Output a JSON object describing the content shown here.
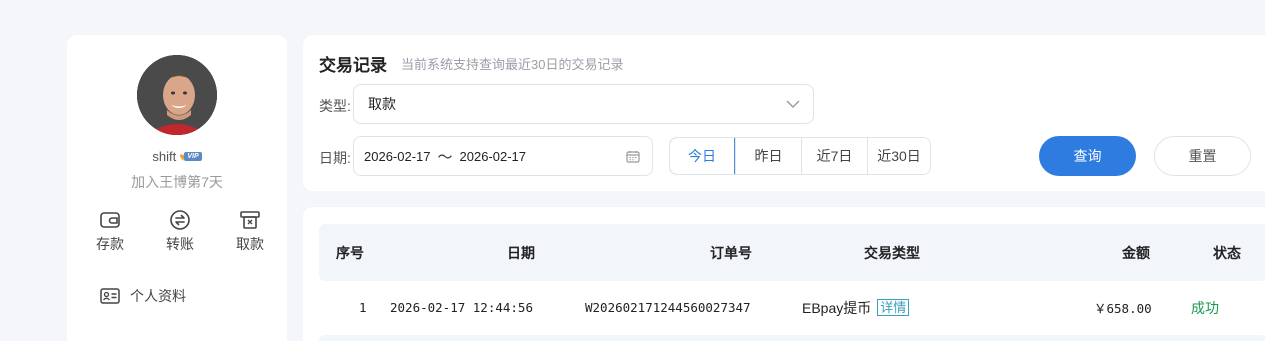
{
  "sidebar": {
    "username": "shift",
    "vip_label": "VIP",
    "join_text": "加入王博第7天",
    "actions": [
      {
        "label": "存款",
        "icon": "wallet-icon"
      },
      {
        "label": "转账",
        "icon": "transfer-icon"
      },
      {
        "label": "取款",
        "icon": "atm-withdraw-icon"
      }
    ],
    "profile_link": {
      "label": "个人资料",
      "icon": "id-card-icon"
    }
  },
  "filter": {
    "title": "交易记录",
    "subtitle": "当前系统支持查询最近30日的交易记录",
    "type_label": "类型:",
    "type_value": "取款",
    "date_label": "日期:",
    "date_start": "2026-02-17",
    "date_sep": "〜",
    "date_end": "2026-02-17",
    "quick_ranges": [
      "今日",
      "昨日",
      "近7日",
      "近30日"
    ],
    "active_range": "今日",
    "query_label": "查询",
    "reset_label": "重置"
  },
  "table": {
    "columns": [
      "序号",
      "日期",
      "订单号",
      "交易类型",
      "金额",
      "状态"
    ],
    "rows": [
      {
        "index": "1",
        "date": "2026-02-17 12:44:56",
        "order_no": "W202602171244560027347",
        "type": "EBpay提币",
        "detail_label": "详情",
        "amount": "￥658.00",
        "status": "成功"
      }
    ]
  },
  "colors": {
    "accent": "#2f7ce0",
    "success": "#1a9a50",
    "detail": "#3a9ec0",
    "page_bg": "#f4f6fa"
  }
}
